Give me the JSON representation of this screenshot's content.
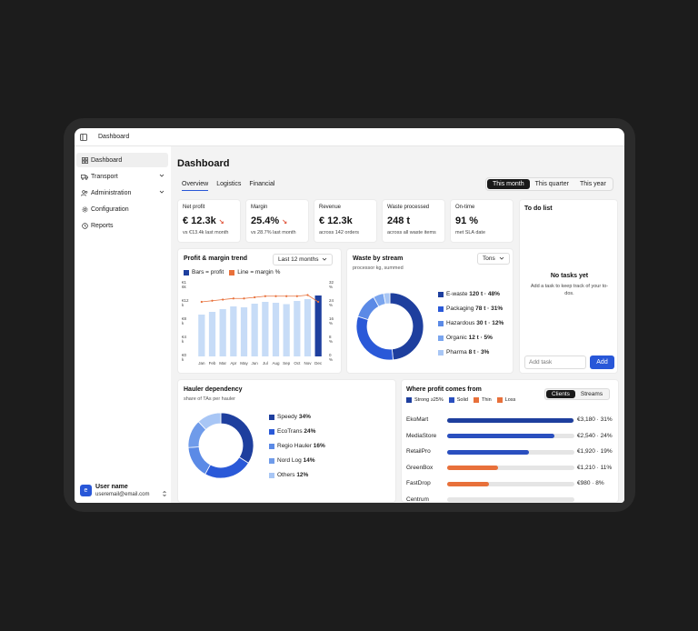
{
  "topbar": {
    "title": "Dashboard"
  },
  "sidebar": {
    "items": [
      {
        "label": "Dashboard",
        "icon": "grid-icon"
      },
      {
        "label": "Transport",
        "icon": "truck-icon"
      },
      {
        "label": "Administration",
        "icon": "users-icon"
      },
      {
        "label": "Configuration",
        "icon": "gear-icon"
      },
      {
        "label": "Reports",
        "icon": "clock-icon"
      }
    ],
    "user": {
      "initial": "e",
      "name": "User name",
      "email": "useremail@email.com"
    }
  },
  "page": {
    "title": "Dashboard",
    "tabs": [
      "Overview",
      "Logistics",
      "Financial"
    ],
    "periods": [
      "This month",
      "This quarter",
      "This year"
    ]
  },
  "kpis": [
    {
      "label": "Net profit",
      "value": "€ 12.3k",
      "sub": "vs €13.4k last month"
    },
    {
      "label": "Margin",
      "value": "25.4%",
      "sub": "vs 28.7% last month"
    },
    {
      "label": "Revenue",
      "value": "€ 12.3k",
      "sub": "across 142 orders"
    },
    {
      "label": "Waste processed",
      "value": "248 t",
      "sub": "across all waste items"
    },
    {
      "label": "On-time",
      "value": "91 %",
      "sub": "met SLA date"
    }
  ],
  "profit_chart": {
    "title": "Profit & margin trend",
    "range": "Last 12 months",
    "legend_bars": "Bars = profit",
    "legend_line": "Line = margin %",
    "yleft": [
      "€1 6k",
      "€12 k",
      "€8 k",
      "€4 k",
      "€0 k"
    ],
    "yright": [
      "32 %",
      "24 %",
      "16 %",
      "8 %",
      "0 %"
    ]
  },
  "chart_data": {
    "type": "bar",
    "categories": [
      "Jan",
      "Feb",
      "Mar",
      "Apr",
      "May",
      "Jun",
      "Jul",
      "Aug",
      "Sep",
      "Oct",
      "Nov",
      "Dec"
    ],
    "series": [
      {
        "name": "profit",
        "values": [
          9.2,
          9.8,
          10.4,
          11.0,
          10.8,
          11.6,
          12.0,
          11.8,
          11.5,
          12.2,
          12.6,
          13.4
        ]
      },
      {
        "name": "margin %",
        "values": [
          24,
          24.5,
          25,
          25.5,
          25.5,
          26,
          26.5,
          26.5,
          26.5,
          26.5,
          27,
          24
        ]
      }
    ],
    "ylim": [
      0,
      16
    ],
    "y2lim": [
      0,
      32
    ],
    "colors": {
      "bar": "#c7dcf7",
      "bar_highlight": "#1e3f9e",
      "line": "#e8703a"
    }
  },
  "waste": {
    "title": "Waste by stream",
    "subtitle": "processor kg, summed",
    "unit": "Tons",
    "items": [
      {
        "name": "E-waste",
        "value": "120 t · 48%",
        "pct": 48,
        "color": "#1e3f9e"
      },
      {
        "name": "Packaging",
        "value": "78 t · 31%",
        "pct": 31,
        "color": "#2a59d8"
      },
      {
        "name": "Hazardous",
        "value": "30 t · 12%",
        "pct": 12,
        "color": "#5b8ae6"
      },
      {
        "name": "Organic",
        "value": "12 t · 5%",
        "pct": 5,
        "color": "#7aa5ee"
      },
      {
        "name": "Pharma",
        "value": "8 t · 3%",
        "pct": 3,
        "color": "#a8c6f5"
      }
    ]
  },
  "todo": {
    "title": "To do list",
    "empty_title": "No tasks yet",
    "empty_text": "Add a task to keep track of your to-dos.",
    "placeholder": "Add task",
    "add_label": "Add"
  },
  "hauler": {
    "title": "Hauler dependency",
    "subtitle": "share of TAs per hauler",
    "items": [
      {
        "name": "Speedy",
        "value": "34%",
        "pct": 34,
        "color": "#1e3f9e"
      },
      {
        "name": "EcoTrans",
        "value": "24%",
        "pct": 24,
        "color": "#2a59d8"
      },
      {
        "name": "Regio Hauler",
        "value": "16%",
        "pct": 16,
        "color": "#5b8ae6"
      },
      {
        "name": "Nord Log",
        "value": "14%",
        "pct": 14,
        "color": "#6f9bea"
      },
      {
        "name": "Others",
        "value": "12%",
        "pct": 12,
        "color": "#a8c6f5"
      }
    ]
  },
  "profit_sources": {
    "title": "Where profit comes from",
    "legend": [
      {
        "label": "Strong ≥25%",
        "color": "#1e3f9e"
      },
      {
        "label": "Solid",
        "color": "#2a4fbf"
      },
      {
        "label": "Thin",
        "color": "#e8703a"
      },
      {
        "label": "Loss",
        "color": "#e8703a"
      }
    ],
    "toggle": [
      "Clients",
      "Streams"
    ],
    "rows": [
      {
        "name": "EkoMart",
        "value": "€3,180 · 31%",
        "fill": 0.99,
        "color": "#1e3f9e"
      },
      {
        "name": "MediaStore",
        "value": "€2,540 · 24%",
        "fill": 0.84,
        "color": "#2a4fbf"
      },
      {
        "name": "RetailPro",
        "value": "€1,920 · 19%",
        "fill": 0.64,
        "color": "#2a4fbf"
      },
      {
        "name": "GreenBox",
        "value": "€1,210 · 11%",
        "fill": 0.4,
        "color": "#e8703a"
      },
      {
        "name": "FastDrop",
        "value": "€980 · 8%",
        "fill": 0.33,
        "color": "#e8703a"
      },
      {
        "name": "Centrum",
        "value": "",
        "fill": 0,
        "color": "#e8703a"
      }
    ]
  }
}
